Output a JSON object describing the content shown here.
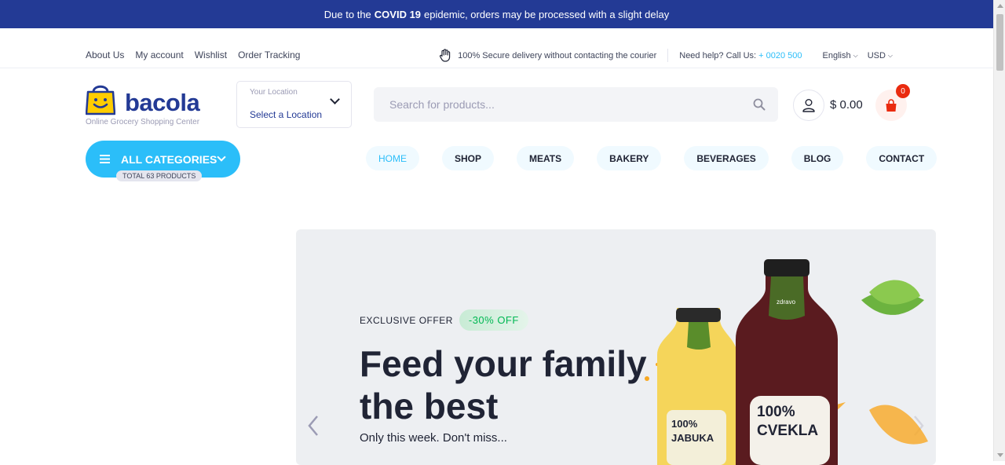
{
  "announcement": {
    "before": "Due to the",
    "bold": "COVID 19",
    "after": "epidemic, orders may be processed with a slight delay"
  },
  "top_links": [
    "About Us",
    "My account",
    "Wishlist",
    "Order Tracking"
  ],
  "top_right": {
    "secure": "100% Secure delivery without contacting the courier",
    "help_label": "Need help? Call Us:",
    "phone": "+ 0020 500",
    "language": "English",
    "currency": "USD"
  },
  "logo": {
    "word": "bacola",
    "tagline": "Online Grocery Shopping Center"
  },
  "location": {
    "label": "Your Location",
    "value": "Select a Location"
  },
  "search": {
    "placeholder": "Search for products..."
  },
  "cart": {
    "total": "$ 0.00",
    "count": "0"
  },
  "categories": {
    "label": "ALL CATEGORIES",
    "count": "TOTAL 63 PRODUCTS"
  },
  "nav": [
    "HOME",
    "SHOP",
    "MEATS",
    "BAKERY",
    "BEVERAGES",
    "BLOG",
    "CONTACT"
  ],
  "hero": {
    "eyebrow": "EXCLUSIVE OFFER",
    "discount": "-30% OFF",
    "title": "Feed your family the best",
    "subtitle": "Only this week. Don't miss...",
    "bottle_left_brand": "100% JABUKA",
    "bottle_right_brand": "100% CVEKLA",
    "bottle_brand": "zdravo"
  },
  "colors": {
    "brand": "#233a95",
    "accent": "#2bbef9",
    "danger": "#ea2b0f",
    "success": "#00b853"
  }
}
